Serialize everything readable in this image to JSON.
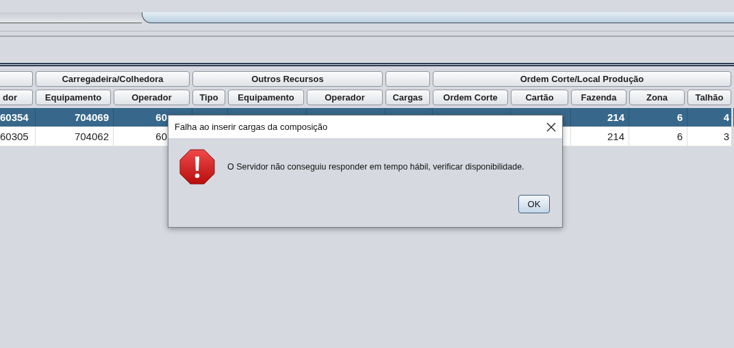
{
  "table": {
    "groups": [
      {
        "columns": [
          "dor"
        ]
      },
      {
        "label": "Carregadeira/Colhedora",
        "columns": [
          "Equipamento",
          "Operador"
        ]
      },
      {
        "label": "Outros Recursos",
        "columns": [
          "Tipo",
          "Equipamento",
          "Operador"
        ]
      },
      {
        "columns": [
          "Cargas"
        ]
      },
      {
        "label": "Ordem Corte/Local Produção",
        "columns": [
          "Ordem Corte",
          "Cartão",
          "Fazenda",
          "Zona",
          "Talhão"
        ]
      }
    ],
    "rows": [
      {
        "selected": true,
        "cells": [
          "60354",
          "704069",
          "60",
          null,
          null,
          null,
          null,
          null,
          null,
          "214",
          "6",
          "4"
        ]
      },
      {
        "selected": false,
        "cells": [
          "60305",
          "704062",
          "60",
          null,
          null,
          null,
          null,
          null,
          null,
          "214",
          "6",
          "3"
        ]
      }
    ]
  },
  "dialog": {
    "title": "Falha ao inserir cargas da composição",
    "message": "O Servidor não conseguiu responder em tempo hábil, verificar disponibilidade.",
    "buttons": [
      "OK"
    ]
  }
}
